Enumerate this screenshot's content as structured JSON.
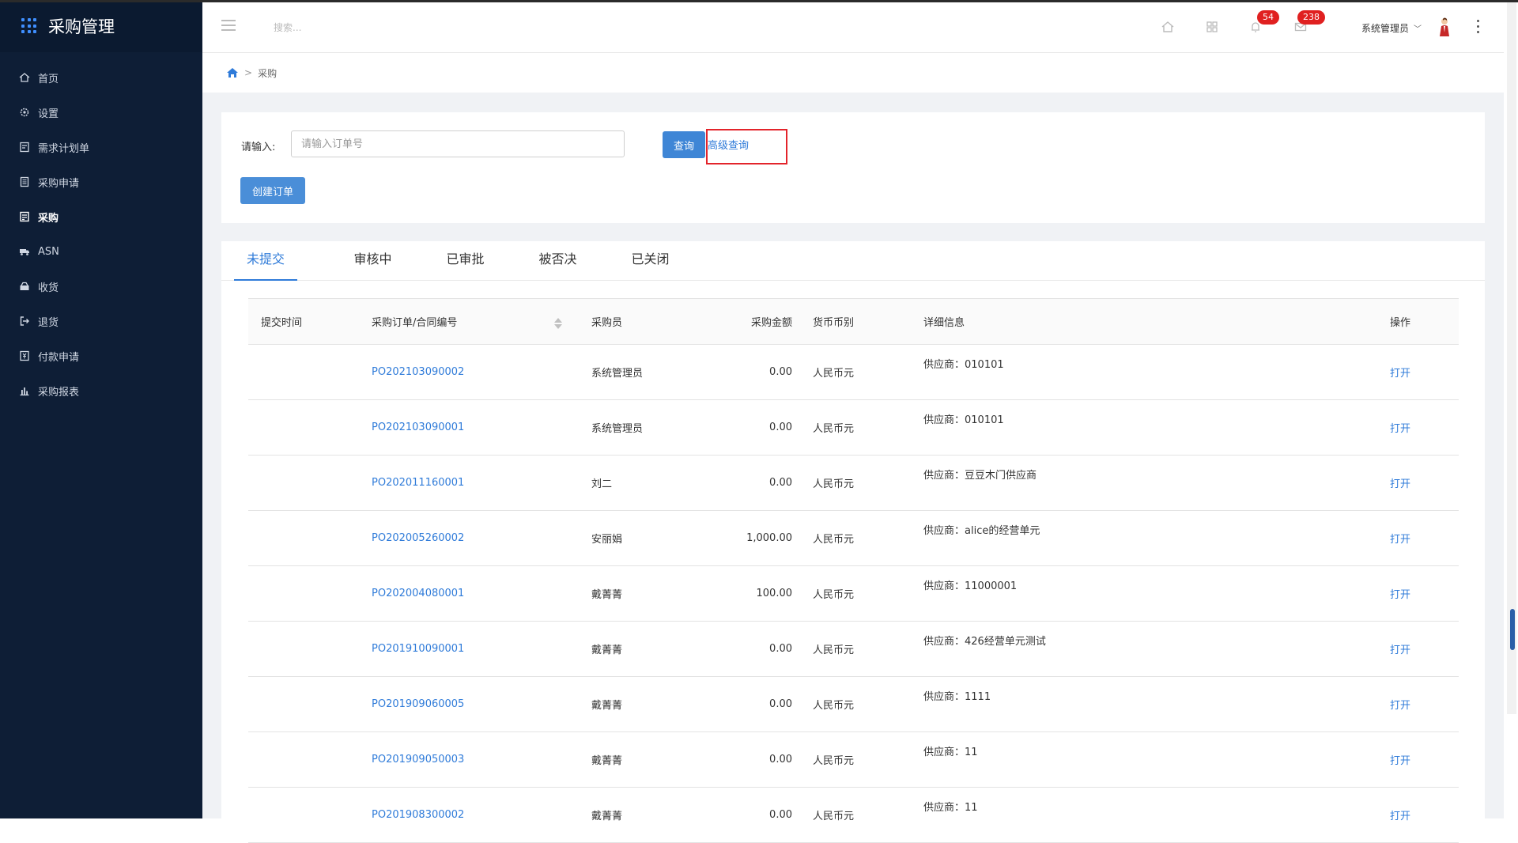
{
  "app": {
    "title": "采购管理"
  },
  "sidebar": {
    "items": [
      {
        "label": "首页",
        "icon": "home-icon"
      },
      {
        "label": "设置",
        "icon": "gear-icon"
      },
      {
        "label": "需求计划单",
        "icon": "plan-icon"
      },
      {
        "label": "采购申请",
        "icon": "request-icon"
      },
      {
        "label": "采购",
        "icon": "purchase-icon",
        "active": true
      },
      {
        "label": "ASN",
        "icon": "truck-icon"
      },
      {
        "label": "收货",
        "icon": "receive-icon"
      },
      {
        "label": "退货",
        "icon": "return-icon"
      },
      {
        "label": "付款申请",
        "icon": "payment-icon"
      },
      {
        "label": "采购报表",
        "icon": "report-icon"
      }
    ]
  },
  "header": {
    "search_placeholder": "搜索...",
    "notifications_count": "54",
    "messages_count": "238",
    "user_name": "系统管理员"
  },
  "breadcrumb": {
    "sep": ">",
    "current": "采购"
  },
  "search_panel": {
    "label": "请输入:",
    "placeholder": "请输入订单号",
    "query_button": "查询",
    "advanced_link": "高级查询",
    "create_button": "创建订单"
  },
  "tabs": [
    "未提交",
    "审核中",
    "已审批",
    "被否决",
    "已关闭"
  ],
  "table": {
    "headers": {
      "submit_time": "提交时间",
      "order_no": "采购订单/合同编号",
      "buyer": "采购员",
      "amount": "采购金额",
      "currency": "货币币别",
      "detail": "详细信息",
      "action": "操作"
    },
    "rows": [
      {
        "submit_time": "",
        "order_no": "PO202103090002",
        "buyer": "系统管理员",
        "amount": "0.00",
        "currency": "人民币元",
        "detail": "供应商：010101",
        "action": "打开"
      },
      {
        "submit_time": "",
        "order_no": "PO202103090001",
        "buyer": "系统管理员",
        "amount": "0.00",
        "currency": "人民币元",
        "detail": "供应商：010101",
        "action": "打开"
      },
      {
        "submit_time": "",
        "order_no": "PO202011160001",
        "buyer": "刘二",
        "amount": "0.00",
        "currency": "人民币元",
        "detail": "供应商：豆豆木门供应商",
        "action": "打开"
      },
      {
        "submit_time": "",
        "order_no": "PO202005260002",
        "buyer": "安丽娟",
        "amount": "1,000.00",
        "currency": "人民币元",
        "detail": "供应商：alice的经营单元",
        "action": "打开"
      },
      {
        "submit_time": "",
        "order_no": "PO202004080001",
        "buyer": "戴菁菁",
        "amount": "100.00",
        "currency": "人民币元",
        "detail": "供应商：11000001",
        "action": "打开"
      },
      {
        "submit_time": "",
        "order_no": "PO201910090001",
        "buyer": "戴菁菁",
        "amount": "0.00",
        "currency": "人民币元",
        "detail": "供应商：426经营单元测试",
        "action": "打开"
      },
      {
        "submit_time": "",
        "order_no": "PO201909060005",
        "buyer": "戴菁菁",
        "amount": "0.00",
        "currency": "人民币元",
        "detail": "供应商：1111",
        "action": "打开"
      },
      {
        "submit_time": "",
        "order_no": "PO201909050003",
        "buyer": "戴菁菁",
        "amount": "0.00",
        "currency": "人民币元",
        "detail": "供应商：11",
        "action": "打开"
      },
      {
        "submit_time": "",
        "order_no": "PO201908300002",
        "buyer": "戴菁菁",
        "amount": "0.00",
        "currency": "人民币元",
        "detail": "供应商：11",
        "action": "打开"
      }
    ]
  }
}
